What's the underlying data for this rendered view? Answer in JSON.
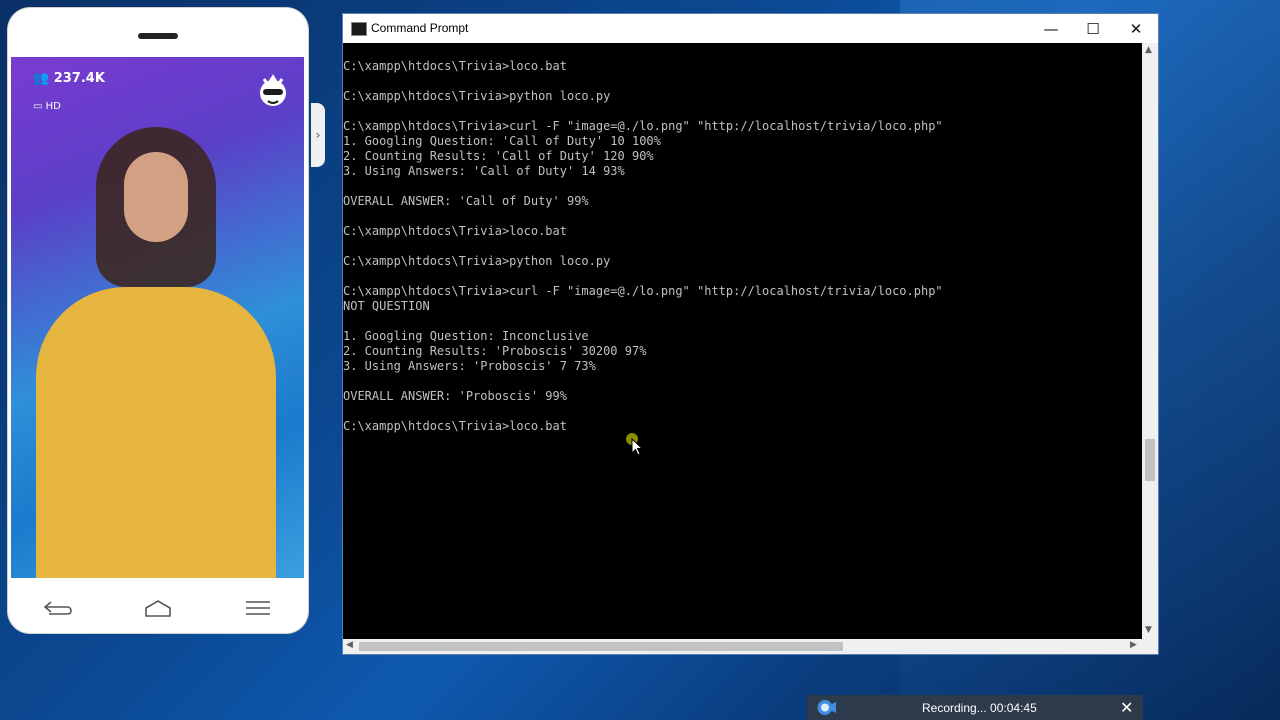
{
  "phone": {
    "viewer_count": "237.4K",
    "quality": "HD",
    "side_arrow": "›"
  },
  "window": {
    "title": "Command Prompt",
    "minimize": "—",
    "maximize": "☐",
    "close": "✕"
  },
  "console": {
    "lines": [
      "C:\\xampp\\htdocs\\Trivia>loco.bat",
      "",
      "C:\\xampp\\htdocs\\Trivia>python loco.py",
      "",
      "C:\\xampp\\htdocs\\Trivia>curl -F \"image=@./lo.png\" \"http://localhost/trivia/loco.php\"",
      "1. Googling Question: 'Call of Duty' 10 100%",
      "2. Counting Results: 'Call of Duty' 120 90%",
      "3. Using Answers: 'Call of Duty' 14 93%",
      "",
      "OVERALL ANSWER: 'Call of Duty' 99%",
      "",
      "C:\\xampp\\htdocs\\Trivia>loco.bat",
      "",
      "C:\\xampp\\htdocs\\Trivia>python loco.py",
      "",
      "C:\\xampp\\htdocs\\Trivia>curl -F \"image=@./lo.png\" \"http://localhost/trivia/loco.php\"",
      "NOT QUESTION",
      "",
      "1. Googling Question: Inconclusive",
      "2. Counting Results: 'Proboscis' 30200 97%",
      "3. Using Answers: 'Proboscis' 7 73%",
      "",
      "OVERALL ANSWER: 'Proboscis' 99%",
      "",
      "C:\\xampp\\htdocs\\Trivia>loco.bat"
    ]
  },
  "recording": {
    "status": "Recording... 00:04:45",
    "close": "✕"
  },
  "icons": {
    "back": "back-icon",
    "home": "home-icon",
    "menu": "menu-icon",
    "viewers": "viewers-icon",
    "hd": "hd-icon",
    "logo": "app-logo-icon",
    "cmd": "cmd-icon",
    "record": "camera-icon"
  }
}
